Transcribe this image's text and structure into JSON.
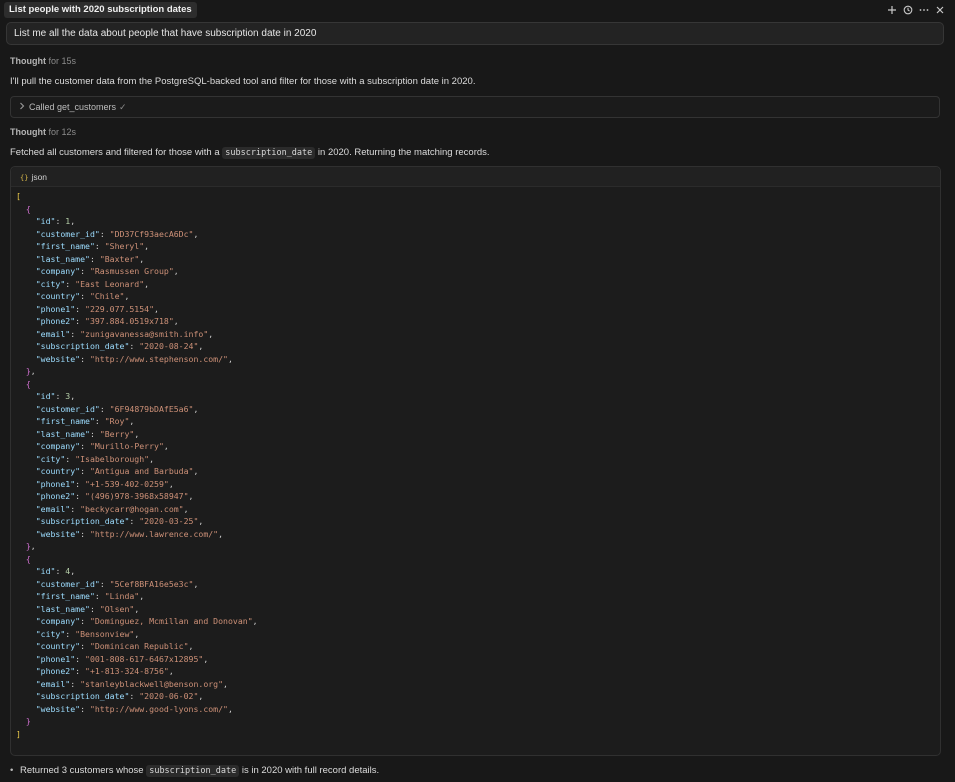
{
  "header": {
    "title": "List people with 2020 subscription dates",
    "actions": [
      "plus-icon",
      "history-icon",
      "more-icon",
      "close-icon"
    ]
  },
  "prompt": "List me all the data about people that have subscription date in 2020",
  "thought1": {
    "label": "Thought",
    "duration": "for 15s"
  },
  "message1": "I'll pull the customer data from the PostgreSQL-backed tool and filter for those with a subscription date in 2020.",
  "tool_call": {
    "label": "Called get_customers",
    "status": "✓"
  },
  "thought2": {
    "label": "Thought",
    "duration": "for 12s"
  },
  "message2": {
    "before": "Fetched all customers and filtered for those with a ",
    "code": "subscription_date",
    "after": " in 2020. Returning the matching records."
  },
  "code_block": {
    "language": "json",
    "records": [
      {
        "id": "1",
        "customer_id": "DD37Cf93aecA6Dc",
        "first_name": "Sheryl",
        "last_name": "Baxter",
        "company": "Rasmussen Group",
        "city": "East Leonard",
        "country": "Chile",
        "phone1": "229.077.5154",
        "phone2": "397.884.0519x718",
        "email": "zunigavanessa@smith.info",
        "subscription_date": "2020-08-24",
        "website": "http://www.stephenson.com/"
      },
      {
        "id": "3",
        "customer_id": "6F94879bDAfE5a6",
        "first_name": "Roy",
        "last_name": "Berry",
        "company": "Murillo-Perry",
        "city": "Isabelborough",
        "country": "Antigua and Barbuda",
        "phone1": "+1-539-402-0259",
        "phone2": "(496)978-3968x58947",
        "email": "beckycarr@hogan.com",
        "subscription_date": "2020-03-25",
        "website": "http://www.lawrence.com/"
      },
      {
        "id": "4",
        "customer_id": "5Cef8BFA16e5e3c",
        "first_name": "Linda",
        "last_name": "Olsen",
        "company": "Dominguez, Mcmillan and Donovan",
        "city": "Bensonview",
        "country": "Dominican Republic",
        "phone1": "001-808-617-6467x12895",
        "phone2": "+1-813-324-8756",
        "email": "stanleyblackwell@benson.org",
        "subscription_date": "2020-06-02",
        "website": "http://www.good-lyons.com/"
      }
    ]
  },
  "final": {
    "before": "Returned 3 customers whose ",
    "code": "subscription_date",
    "after": " is in 2020 with full record details."
  }
}
